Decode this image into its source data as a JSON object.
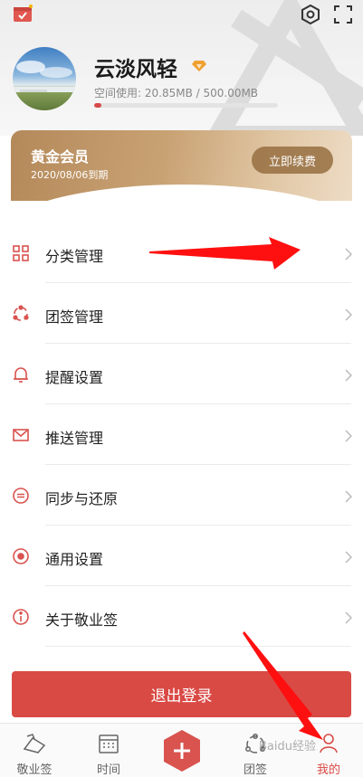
{
  "profile": {
    "username": "云淡风轻",
    "storage_text": "空间使用: 20.85MB / 500.00MB",
    "storage_fraction": 0.0417
  },
  "vip_card": {
    "title": "黄金会员",
    "expire": "2020/08/06到期",
    "renew_label": "立即续费"
  },
  "menu": {
    "items": [
      {
        "label": "分类管理",
        "icon": "category-icon"
      },
      {
        "label": "团签管理",
        "icon": "team-icon"
      },
      {
        "label": "提醒设置",
        "icon": "bell-icon"
      },
      {
        "label": "推送管理",
        "icon": "mail-icon"
      },
      {
        "label": "同步与还原",
        "icon": "sync-icon"
      },
      {
        "label": "通用设置",
        "icon": "settings-dot-icon"
      },
      {
        "label": "关于敬业签",
        "icon": "info-icon"
      }
    ]
  },
  "logout_label": "退出登录",
  "bottom_nav": {
    "items": [
      {
        "label": "敬业签",
        "icon": "note-icon"
      },
      {
        "label": "时间",
        "icon": "calendar-icon"
      },
      {
        "label": "团签",
        "icon": "team-nav-icon"
      },
      {
        "label": "我的",
        "icon": "profile-icon"
      }
    ],
    "watermark": "Baidu经验"
  },
  "colors": {
    "accent": "#d94a45",
    "gold": "#c9a274",
    "active_nav": "#d94a45"
  }
}
